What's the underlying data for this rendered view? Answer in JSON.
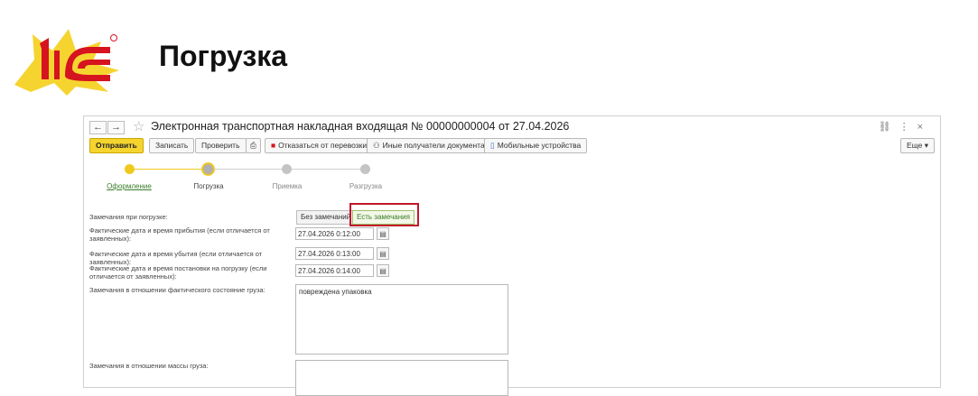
{
  "slide": {
    "title": "Погрузка"
  },
  "colors": {
    "brand_red": "#d5141f",
    "brand_yellow": "#f6d42f",
    "accent_green": "#3a7d2a",
    "highlight": "#c0182b"
  },
  "window": {
    "back_icon": "arrow-left-icon",
    "forward_icon": "arrow-right-icon",
    "favorite_icon": "star-icon",
    "title": "Электронная транспортная накладная входящая № 00000000004 от 27.04.2026",
    "icons": [
      "link-icon",
      "more-vertical-icon",
      "close-icon"
    ],
    "back": "←",
    "forward": "→",
    "link": "⛓",
    "menu": "⋮",
    "close": "×"
  },
  "toolbar": {
    "send": "Отправить",
    "save": "Записать",
    "check": "Проверить",
    "print_icon": "printer-icon",
    "refuse": "Отказаться от перевозки",
    "recipients": "Иные получатели документа",
    "mobile": "Мобильные устройства",
    "more": "Еще"
  },
  "steps": [
    {
      "label": "Оформление",
      "state": "done"
    },
    {
      "label": "Погрузка",
      "state": "current"
    },
    {
      "label": "Приемка",
      "state": "todo"
    },
    {
      "label": "Разгрузка",
      "state": "todo"
    }
  ],
  "form": {
    "remarks_label": "Замечания при погрузке:",
    "toggle_none": "Без замечаний",
    "toggle_has": "Есть замечания",
    "toggle_selected": "Есть замечания",
    "arrival_label": "Фактические дата и время прибытия (если отличается от заявленных):",
    "arrival_value": "27.04.2026  0:12:00",
    "departure_label": "Фактические дата и время убытия (если отличается от заявленных):",
    "departure_value": "27.04.2026  0:13:00",
    "loading_label": "Фактические дата и время постановки на погрузку (если отличается от заявленных):",
    "loading_value": "27.04.2026  0:14:00",
    "condition_label": "Замечания в отношении фактического состояние груза:",
    "condition_value": "повреждена упаковка",
    "mass_label": "Замечания в отношении массы груза:",
    "mass_value": ""
  }
}
